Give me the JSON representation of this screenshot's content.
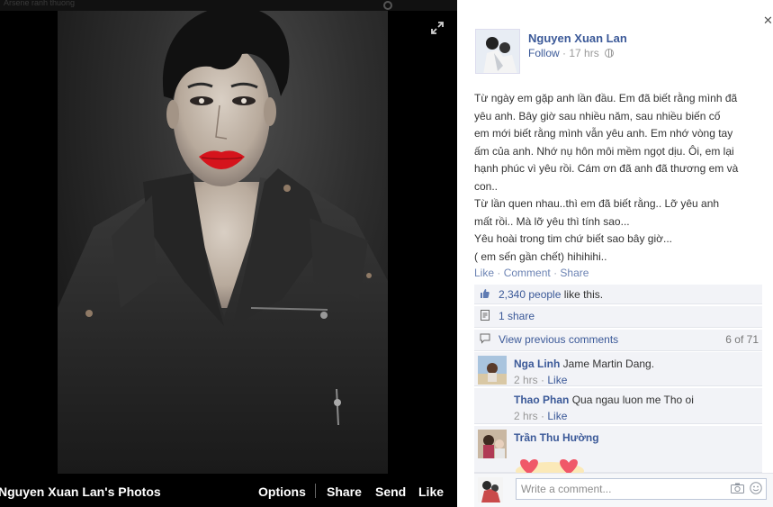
{
  "window": {
    "faded_top_text": "Arsene ranh thuong"
  },
  "photo_viewer": {
    "album_title": "Nguyen Xuan Lan's Photos",
    "options_label": "Options",
    "share_label": "Share",
    "send_label": "Send",
    "like_label": "Like"
  },
  "post": {
    "author": "Nguyen Xuan Lan",
    "follow_label": "Follow",
    "separator": "·",
    "time": "17 hrs",
    "text_lines": [
      "Từ ngày em gặp anh lần đầu. Em đã biết rằng mình đã",
      "yêu anh. Bây giờ sau nhiều năm, sau nhiều biến cố",
      "em mới biết rằng mình vẫn yêu anh. Em nhớ vòng tay",
      "ấm của anh. Nhớ nụ hôn môi mềm ngọt dịu. Ôi, em lại",
      "hạnh phúc vì yêu rồi. Cám ơn đã anh đã thương em và",
      "con..",
      "Từ lần quen nhau..thì em đã biết rằng.. Lỡ yêu anh",
      "mất rồi.. Mà lỡ yêu thì tính sao...",
      "Yêu hoài trong tim chứ biết sao bây giờ...",
      "( em sến gần chết) hihihihi.."
    ],
    "actions": {
      "like": "Like",
      "comment": "Comment",
      "share": "Share",
      "dot": "·"
    },
    "likes": {
      "people": "2,340 people",
      "suffix": "like this."
    },
    "shares": "1 share",
    "previous_comments": {
      "label": "View previous comments",
      "count": "6 of 71"
    },
    "comments": [
      {
        "name": "Nga Linh",
        "text": "Jame Martin Dang.",
        "time": "2 hrs",
        "like": "Like"
      },
      {
        "name": "Thao Phan",
        "text": "Qua ngau luon me Tho oi",
        "time": "2 hrs",
        "like": "Like"
      },
      {
        "name": "Trần Thu Hường",
        "text": ""
      }
    ],
    "composer_placeholder": "Write a comment..."
  },
  "icons": [
    "expand-icon",
    "close-icon",
    "globe-icon",
    "thumbs-up-icon",
    "share-icon",
    "comments-icon",
    "camera-icon",
    "emoji-icon",
    "heart-icon"
  ],
  "colors": {
    "link_blue": "#3b5998",
    "lipstick_red": "#d5141c",
    "panel_bg": "#f2f3f7"
  }
}
